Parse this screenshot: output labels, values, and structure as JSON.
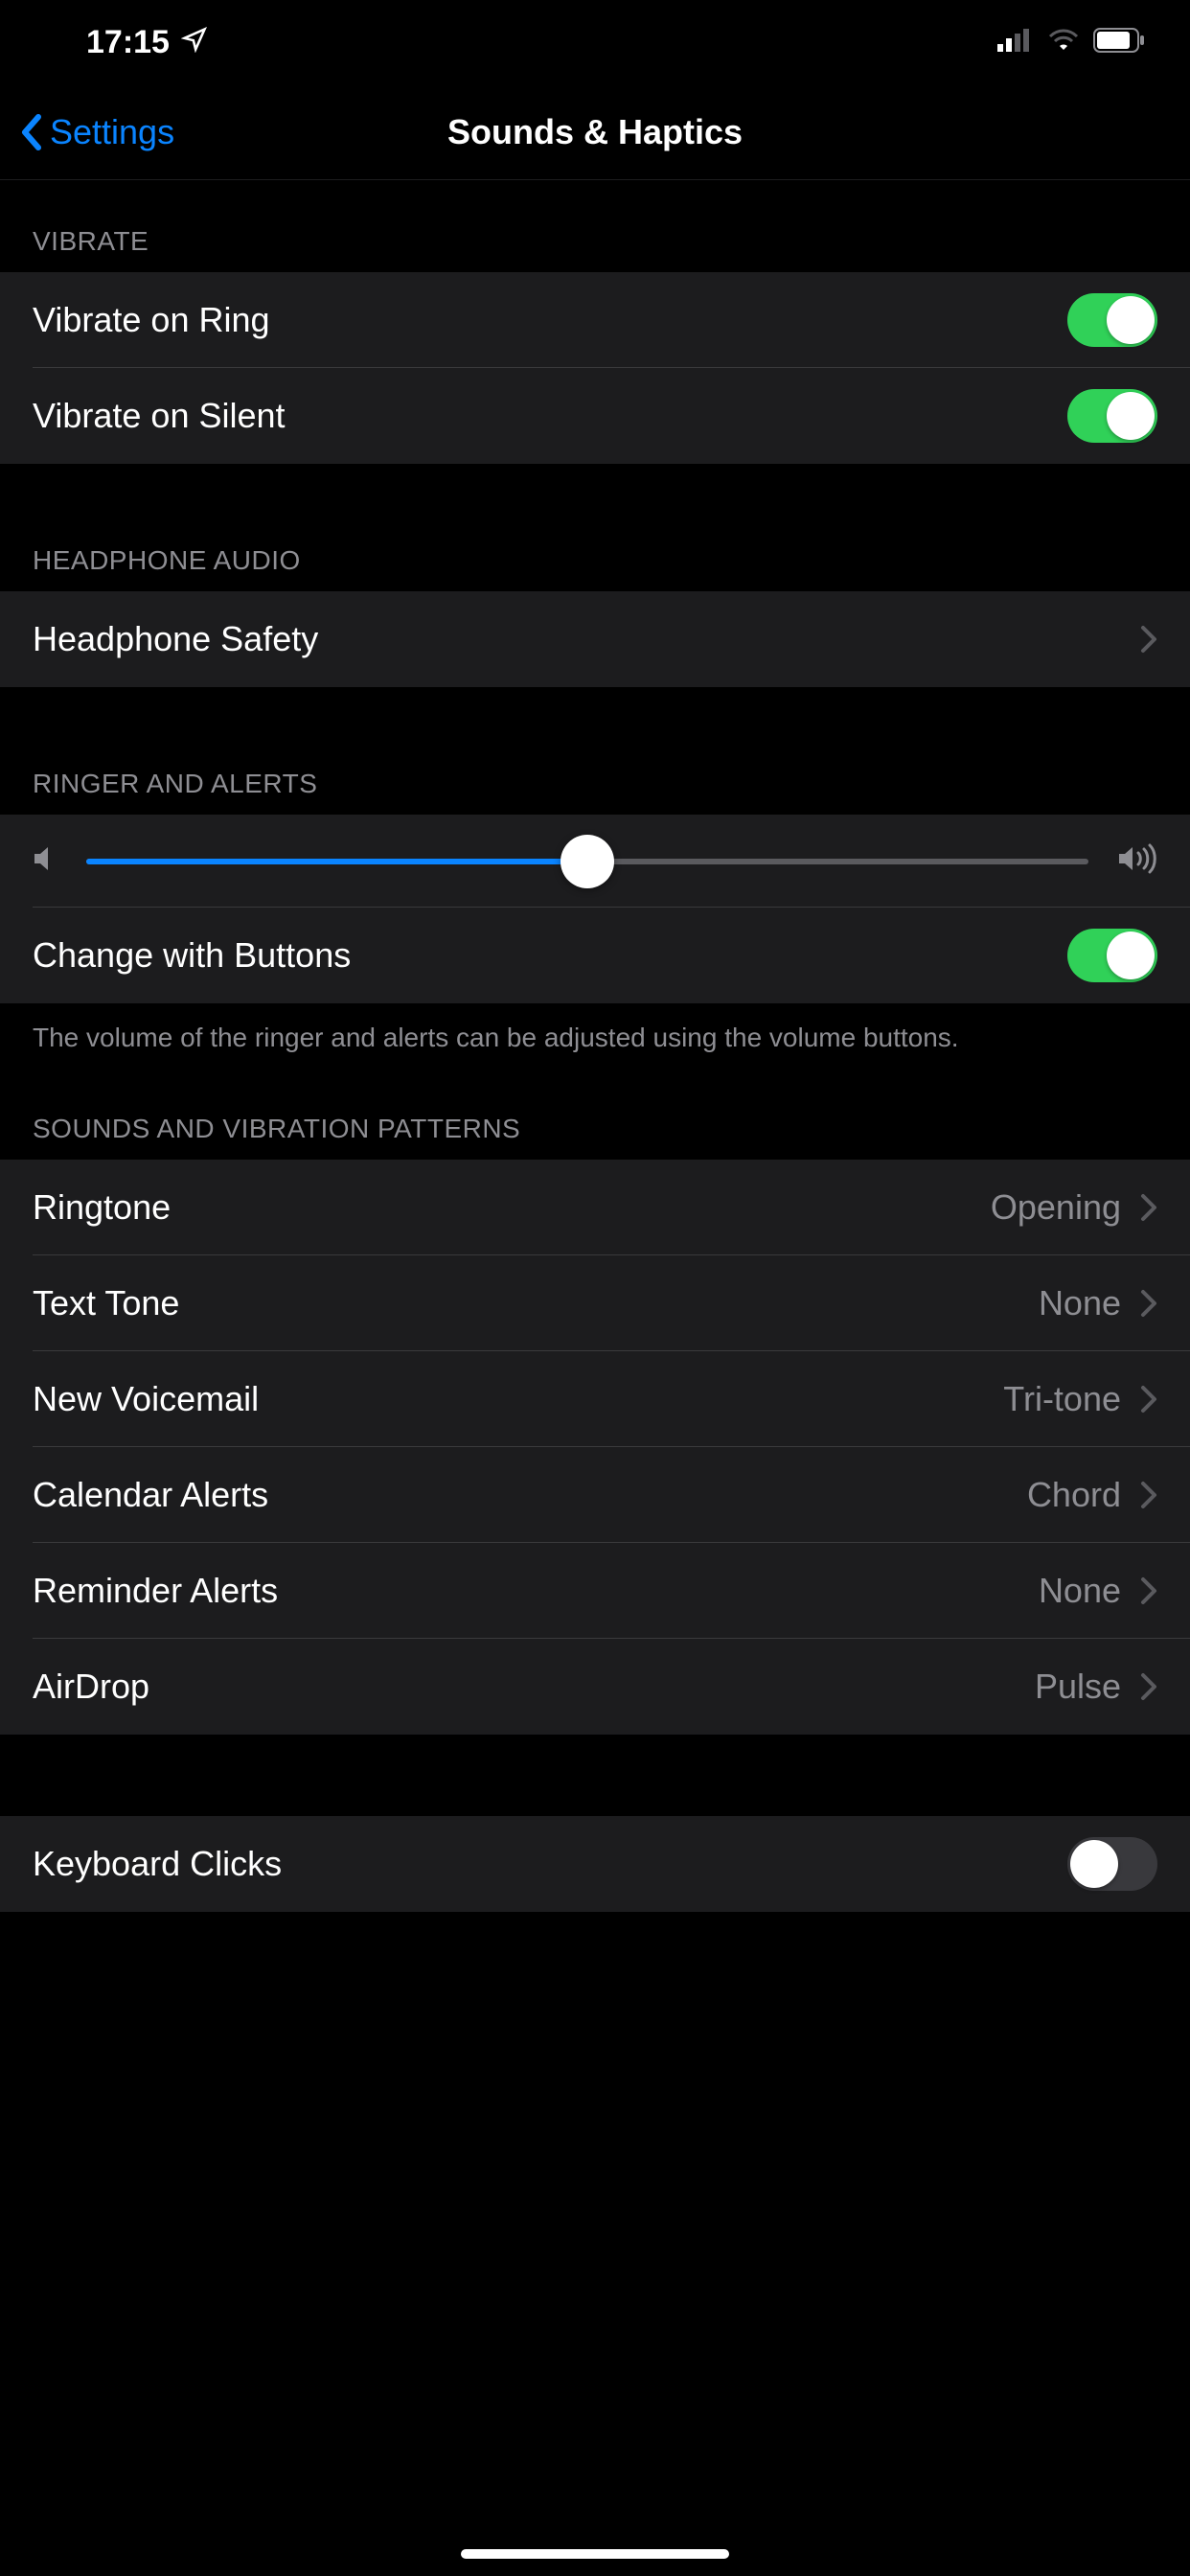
{
  "statusBar": {
    "time": "17:15"
  },
  "nav": {
    "back": "Settings",
    "title": "Sounds & Haptics"
  },
  "sections": {
    "vibrate": {
      "header": "VIBRATE",
      "items": [
        {
          "label": "Vibrate on Ring",
          "on": true
        },
        {
          "label": "Vibrate on Silent",
          "on": true
        }
      ]
    },
    "headphone": {
      "header": "HEADPHONE AUDIO",
      "items": [
        {
          "label": "Headphone Safety"
        }
      ]
    },
    "ringer": {
      "header": "RINGER AND ALERTS",
      "sliderValue": 50,
      "changeWithButtons": {
        "label": "Change with Buttons",
        "on": true
      },
      "footer": "The volume of the ringer and alerts can be adjusted using the volume buttons."
    },
    "sounds": {
      "header": "SOUNDS AND VIBRATION PATTERNS",
      "items": [
        {
          "label": "Ringtone",
          "value": "Opening"
        },
        {
          "label": "Text Tone",
          "value": "None"
        },
        {
          "label": "New Voicemail",
          "value": "Tri-tone"
        },
        {
          "label": "Calendar Alerts",
          "value": "Chord"
        },
        {
          "label": "Reminder Alerts",
          "value": "None"
        },
        {
          "label": "AirDrop",
          "value": "Pulse"
        }
      ]
    },
    "keyboard": {
      "items": [
        {
          "label": "Keyboard Clicks",
          "on": false
        }
      ]
    }
  }
}
